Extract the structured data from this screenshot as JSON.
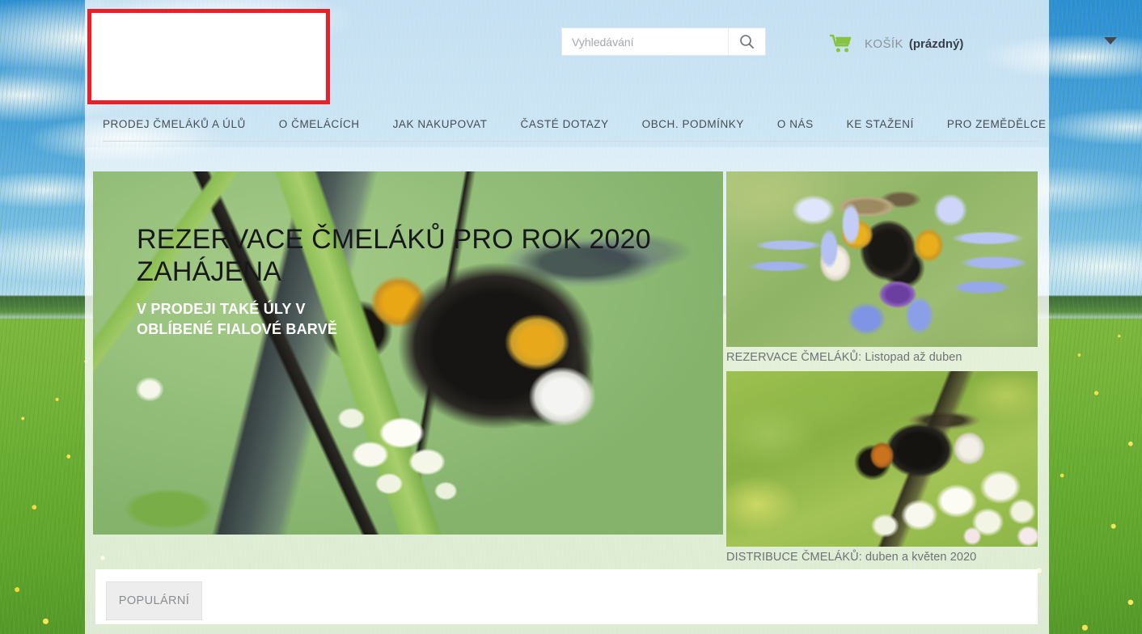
{
  "header": {
    "logo": {
      "name": "site-logo-placeholder",
      "highlight_color": "#e8202a"
    },
    "search": {
      "placeholder": "Vyhledávání",
      "value": "",
      "icon": "search-icon"
    },
    "cart": {
      "icon": "shopping-cart-icon",
      "icon_color": "#8bc34a",
      "label": "KOŠÍK",
      "status": "(prázdný)",
      "caret": "chevron-down-icon"
    }
  },
  "nav": {
    "items": [
      {
        "label": "PRODEJ ČMELÁKŮ A ÚLŮ"
      },
      {
        "label": "O ČMELÁCÍCH"
      },
      {
        "label": "JAK NAKUPOVAT"
      },
      {
        "label": "ČASTÉ DOTAZY"
      },
      {
        "label": "OBCH. PODMÍNKY"
      },
      {
        "label": "O NÁS"
      },
      {
        "label": "KE STAŽENÍ"
      },
      {
        "label": "PRO ZEMĚDĚLCE"
      }
    ]
  },
  "hero": {
    "title": "REZERVACE ČMELÁKŮ PRO ROK 2020 ZAHÁJENA",
    "subtitle": "V PRODEJI TAKÉ ÚLY V OBLÍBENÉ FIALOVÉ BARVĚ",
    "background_color": "#9ac47e",
    "image_alt": "bumblebee-on-white-flower"
  },
  "teasers": [
    {
      "caption": "REZERVACE ČMELÁKŮ: Listopad až duben",
      "image_alt": "bumblebee-on-blue-cornflower"
    },
    {
      "caption": "DISTRIBUCE ČMELÁKŮ: duben a květen 2020",
      "image_alt": "bumblebee-on-white-blossoms"
    }
  ],
  "tabs": {
    "items": [
      {
        "label": "POPULÁRNÍ",
        "active": true
      }
    ]
  },
  "theme": {
    "page_background_alt": "sky-and-meadow-photo",
    "accent_green": "#8bc34a",
    "text_dark": "#454d55",
    "text_muted": "#8d9297"
  }
}
